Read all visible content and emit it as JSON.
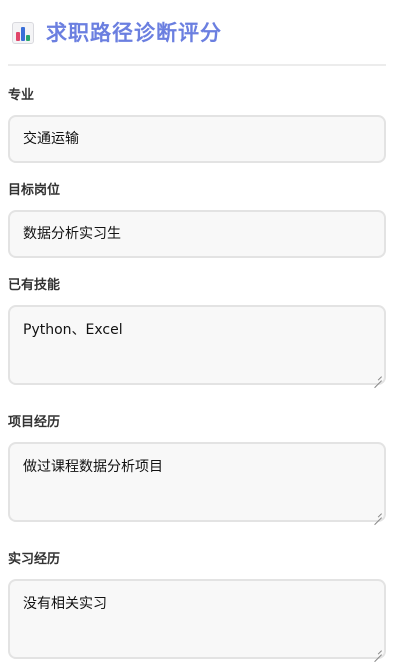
{
  "header": {
    "icon": "bar-chart-icon",
    "title": "求职路径诊断评分"
  },
  "form": {
    "major": {
      "label": "专业",
      "value": "交通运输"
    },
    "target_position": {
      "label": "目标岗位",
      "value": "数据分析实习生"
    },
    "skills": {
      "label": "已有技能",
      "value": "Python、Excel"
    },
    "projects": {
      "label": "项目经历",
      "value": "做过课程数据分析项目"
    },
    "internship": {
      "label": "实习经历",
      "value": "没有相关实习"
    }
  },
  "colors": {
    "title": "#6b7fe0",
    "field_bg": "#f8f8f8",
    "field_border": "#e3e3e3"
  }
}
